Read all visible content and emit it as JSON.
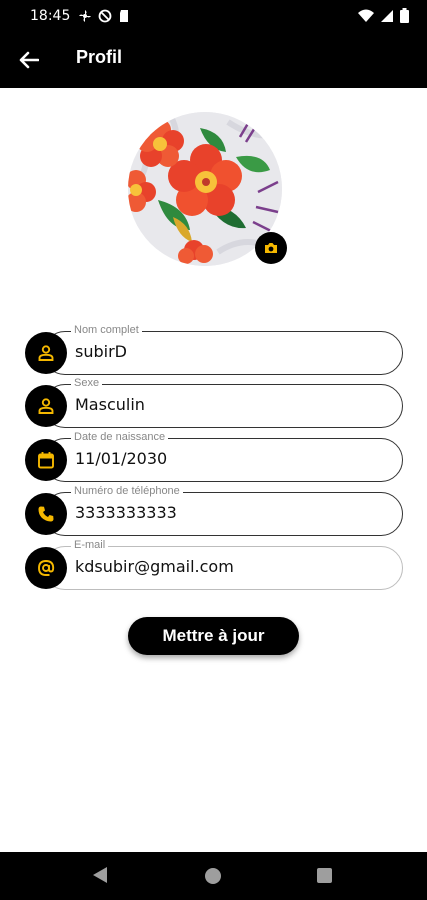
{
  "status_bar": {
    "time": "18:45",
    "icons": [
      "fan-icon",
      "blocked-icon",
      "sd-card-icon",
      "wifi-icon",
      "signal-icon",
      "battery-icon"
    ]
  },
  "app_bar": {
    "title": "Profil",
    "back_icon": "arrow-left-icon"
  },
  "profile": {
    "avatar_image": "red-flower-embroidery",
    "camera_icon": "camera-icon"
  },
  "fields": [
    {
      "label": "Nom complet",
      "value": "subirD",
      "icon": "person-icon"
    },
    {
      "label": "Sexe",
      "value": "Masculin",
      "icon": "person-icon"
    },
    {
      "label": "Date de naissance",
      "value": "11/01/2030",
      "icon": "calendar-icon"
    },
    {
      "label": "Numéro de téléphone",
      "value": "3333333333",
      "icon": "phone-icon"
    },
    {
      "label": "E-mail",
      "value": "kdsubir@gmail.com",
      "icon": "at-icon"
    }
  ],
  "actions": {
    "update_label": "Mettre à jour"
  },
  "colors": {
    "accent": "#F5B800",
    "bar_background": "#000000",
    "page_background": "#FFFFFF"
  }
}
